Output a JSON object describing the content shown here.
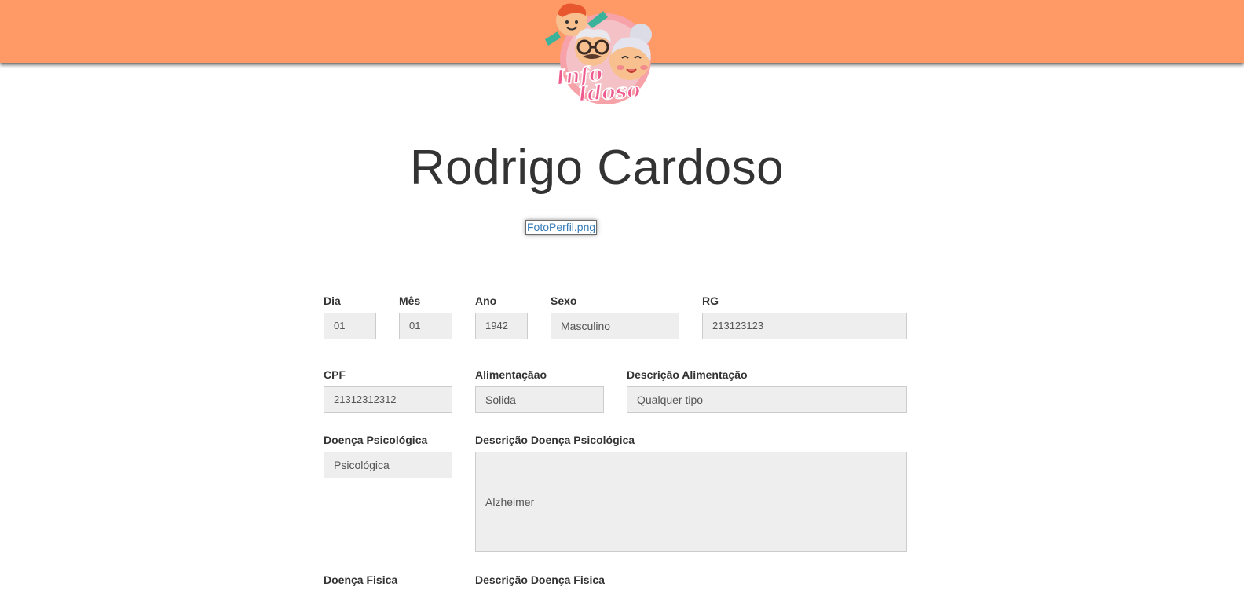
{
  "header": {
    "logo_text": "InfoIdoso"
  },
  "profile": {
    "name": "Rodrigo Cardoso",
    "photo_link": "FotoPerfil.png"
  },
  "form": {
    "dia": {
      "label": "Dia",
      "value": "01"
    },
    "mes": {
      "label": "Mês",
      "value": "01"
    },
    "ano": {
      "label": "Ano",
      "value": "1942"
    },
    "sexo": {
      "label": "Sexo",
      "value": "Masculino"
    },
    "rg": {
      "label": "RG",
      "value": "213123123"
    },
    "cpf": {
      "label": "CPF",
      "value": "21312312312"
    },
    "alimentacao": {
      "label": "Alimentaçãao",
      "value": "Solida"
    },
    "descricao_alimentacao": {
      "label": "Descrição Alimentação",
      "value": "Qualquer tipo"
    },
    "doenca_psicologica": {
      "label": "Doença Psicológica",
      "value": "Psicológica"
    },
    "descricao_doenca_psicologica": {
      "label": "Descrição Doença Psicológica",
      "value": "Alzheimer"
    },
    "doenca_fisica": {
      "label": "Doença Fisica"
    },
    "descricao_doenca_fisica": {
      "label": "Descrição Doença Fisica"
    }
  },
  "colors": {
    "header_bg": "#ff9966",
    "link": "#337ab7",
    "field_bg": "#eeeeee"
  }
}
